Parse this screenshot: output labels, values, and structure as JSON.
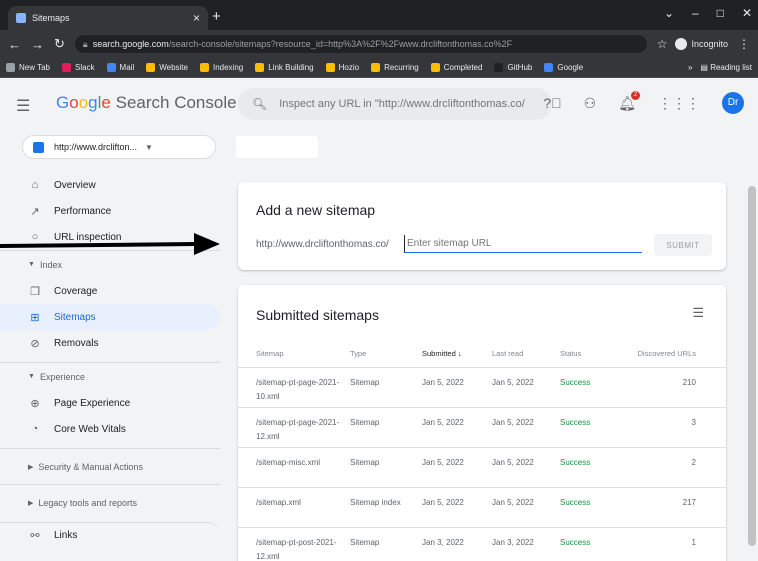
{
  "browser": {
    "tab_title": "Sitemaps",
    "url_host": "search.google.com",
    "url_path": "/search-console/sitemaps?resource_id=http%3A%2F%2Fwww.drcliftonthomas.co%2F",
    "incognito_label": "Incognito",
    "bookmarks": [
      "New Tab",
      "Slack",
      "Mail",
      "Website",
      "Indexing",
      "Link Building",
      "Hozio",
      "Recurring",
      "Completed",
      "GitHub",
      "Google"
    ],
    "reading_list": "Reading list",
    "bookmark_more": "»"
  },
  "app": {
    "brand": {
      "g1": "G",
      "g2": "o",
      "g3": "o",
      "g4": "g",
      "g5": "l",
      "g6": "e",
      "rest": " Search Console"
    },
    "search_placeholder": "Inspect any URL in \"http://www.drcliftonthomas.co/",
    "avatar_initials": "Dr",
    "notification_count": "2"
  },
  "sidebar": {
    "property": "http://www.drclifton...",
    "top_items": [
      {
        "label": "Overview",
        "icon": "home-icon"
      },
      {
        "label": "Performance",
        "icon": "trend-icon"
      },
      {
        "label": "URL inspection",
        "icon": "search-icon"
      }
    ],
    "sections": [
      {
        "label": "Index",
        "items": [
          {
            "label": "Coverage",
            "icon": "coverage-icon"
          },
          {
            "label": "Sitemaps",
            "icon": "sitemap-icon"
          },
          {
            "label": "Removals",
            "icon": "removals-icon"
          }
        ]
      },
      {
        "label": "Experience",
        "items": [
          {
            "label": "Page Experience",
            "icon": "page-experience-icon"
          },
          {
            "label": "Core Web Vitals",
            "icon": "gauge-icon"
          }
        ]
      },
      {
        "label": "Security & Manual Actions"
      },
      {
        "label": "Legacy tools and reports"
      }
    ],
    "links_label": "Links"
  },
  "add_sitemap": {
    "title": "Add a new sitemap",
    "prefix": "http://www.drcliftonthomas.co/",
    "placeholder": "Enter sitemap URL",
    "submit_label": "SUBMIT"
  },
  "submitted": {
    "title": "Submitted sitemaps",
    "columns": [
      "Sitemap",
      "Type",
      "Submitted",
      "Last read",
      "Status",
      "Discovered URLs"
    ],
    "sort_arrow": "↓",
    "rows": [
      {
        "sitemap": "/sitemap-pt-page-2021-10.xml",
        "type": "Sitemap",
        "submitted": "Jan 5, 2022",
        "last_read": "Jan 5, 2022",
        "status": "Success",
        "urls": "210"
      },
      {
        "sitemap": "/sitemap-pt-page-2021-12.xml",
        "type": "Sitemap",
        "submitted": "Jan 5, 2022",
        "last_read": "Jan 5, 2022",
        "status": "Success",
        "urls": "3"
      },
      {
        "sitemap": "/sitemap-misc.xml",
        "type": "Sitemap",
        "submitted": "Jan 5, 2022",
        "last_read": "Jan 5, 2022",
        "status": "Success",
        "urls": "2"
      },
      {
        "sitemap": "/sitemap.xml",
        "type": "Sitemap index",
        "submitted": "Jan 5, 2022",
        "last_read": "Jan 5, 2022",
        "status": "Success",
        "urls": "217"
      },
      {
        "sitemap": "/sitemap-pt-post-2021-12.xml",
        "type": "Sitemap",
        "submitted": "Jan 3, 2022",
        "last_read": "Jan 3, 2022",
        "status": "Success",
        "urls": "1"
      }
    ]
  }
}
